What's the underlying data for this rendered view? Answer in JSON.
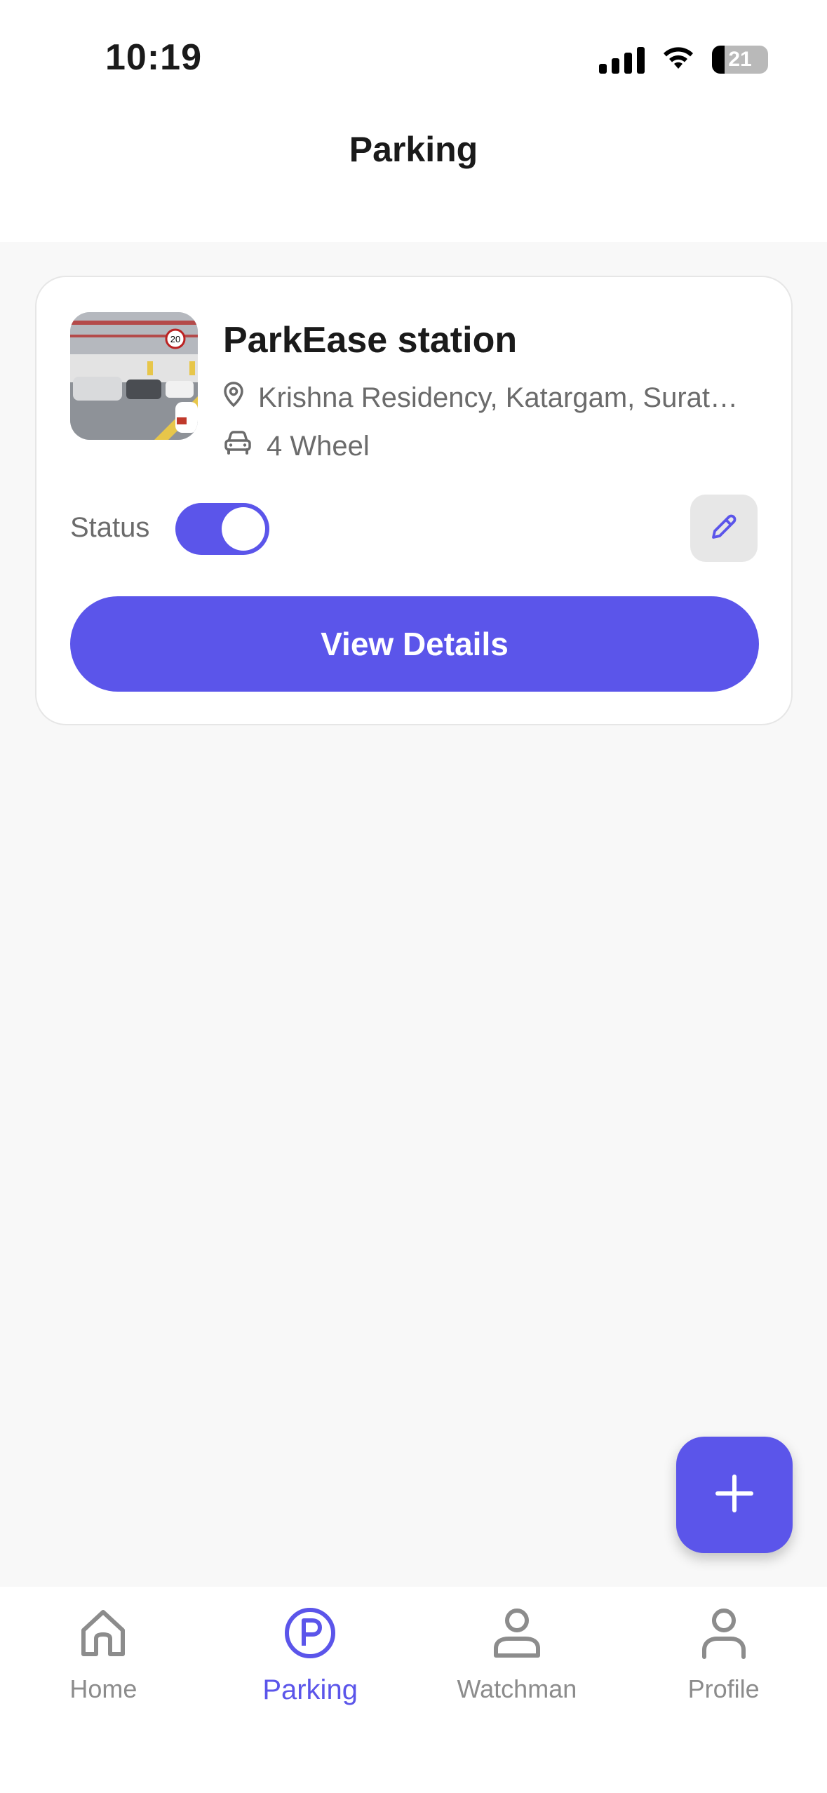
{
  "status_bar": {
    "time": "10:19",
    "battery": "21"
  },
  "header": {
    "title": "Parking"
  },
  "parking_card": {
    "name": "ParkEase station",
    "address": "Krishna Residency, Katargam, Surat, ...",
    "vehicle_type": "4 Wheel",
    "status_label": "Status",
    "status_on": true,
    "view_details_label": "View Details"
  },
  "bottom_nav": {
    "items": [
      {
        "label": "Home",
        "icon": "home-icon",
        "active": false
      },
      {
        "label": "Parking",
        "icon": "parking-icon",
        "active": true
      },
      {
        "label": "Watchman",
        "icon": "watchman-icon",
        "active": false
      },
      {
        "label": "Profile",
        "icon": "profile-icon",
        "active": false
      }
    ]
  },
  "colors": {
    "accent": "#5b55ea",
    "inactive": "#8c8c8c",
    "muted_text": "#6b6b6b"
  }
}
